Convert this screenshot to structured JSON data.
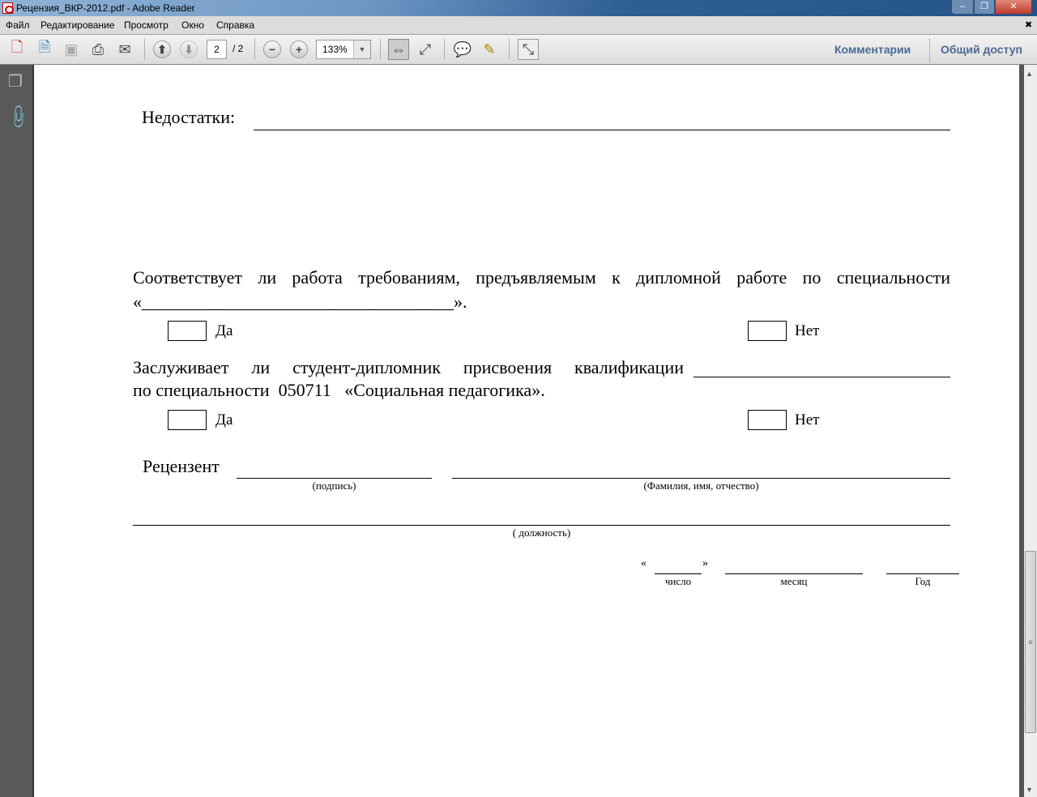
{
  "window": {
    "title": "Рецензия_ВКР-2012.pdf - Adobe Reader",
    "minimize": "–",
    "restore": "❐",
    "close": "✕"
  },
  "menu": [
    "Файл",
    "Редактирование",
    "Просмотр",
    "Окно",
    "Справка"
  ],
  "menu_close": "✖",
  "toolbar": {
    "page_current": "2",
    "page_total": "/ 2",
    "zoom": "133%",
    "comments": "Комментарии",
    "share": "Общий доступ"
  },
  "document": {
    "shortcomings_label": "Недостатки:",
    "q1": "Соответствует ли работа требованиям, предъявляемым к дипломной работе по специальности",
    "q1_blank": "«___________________________________».",
    "yes": "Да",
    "no": "Нет",
    "q2": "Заслуживает ли студент-дипломник присвоения квалификации",
    "q2_line2": "по специальности  050711   «Социальная педагогика».",
    "reviewer": "Рецензент",
    "signature": "(подпись)",
    "full_name": "(Фамилия, имя, отчество)",
    "position": "( должность)",
    "quote_open": "«",
    "quote_close": "»",
    "day": "число",
    "month": "месяц",
    "year": "Год"
  }
}
